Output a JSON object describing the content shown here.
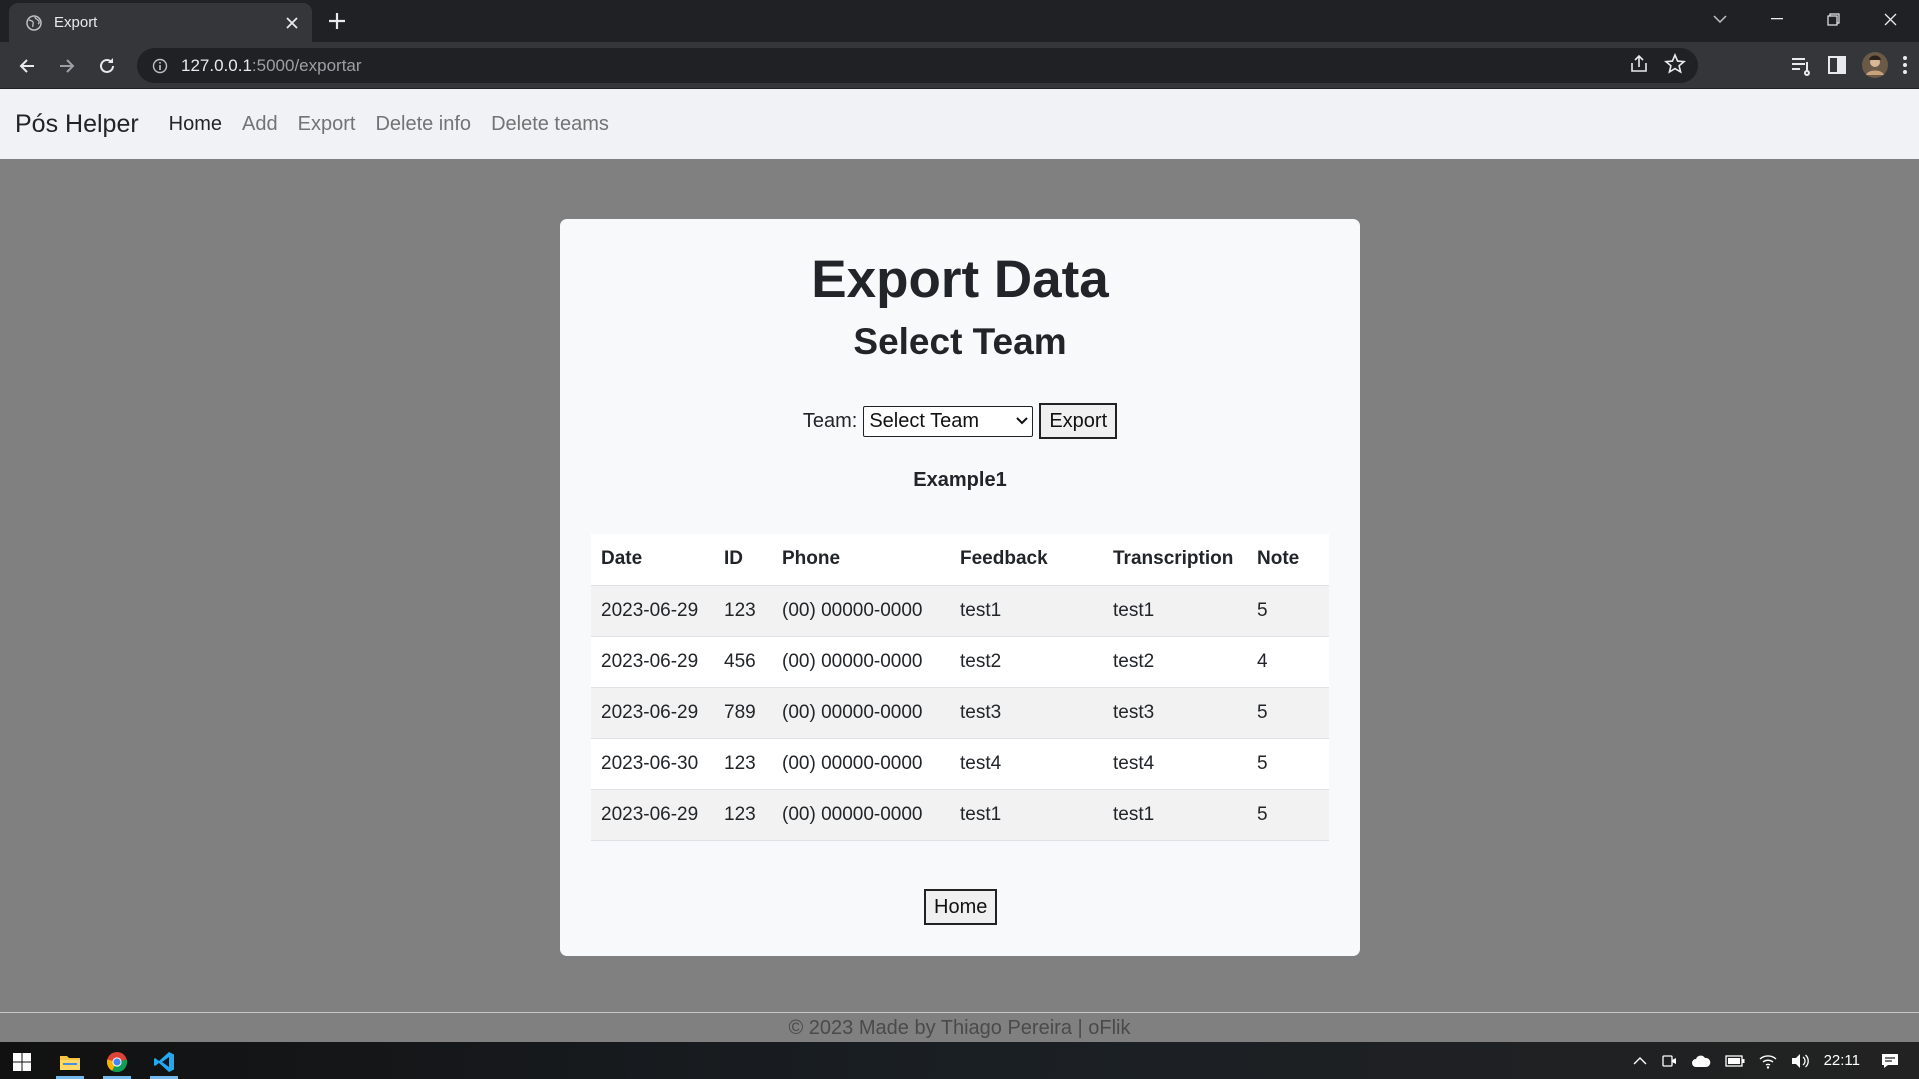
{
  "browser": {
    "tab_title": "Export",
    "url_host": "127.0.0.1",
    "url_path": ":5000/exportar"
  },
  "navbar": {
    "brand": "Pós Helper",
    "links": [
      {
        "label": "Home",
        "active": true
      },
      {
        "label": "Add",
        "active": false
      },
      {
        "label": "Export",
        "active": false
      },
      {
        "label": "Delete info",
        "active": false
      },
      {
        "label": "Delete teams",
        "active": false
      }
    ]
  },
  "page": {
    "title": "Export Data",
    "subtitle": "Select Team",
    "form": {
      "label": "Team:",
      "selected": "Select Team",
      "submit_label": "Export"
    },
    "team_name": "Example1",
    "table": {
      "headers": [
        "Date",
        "ID",
        "Phone",
        "Feedback",
        "Transcription",
        "Note"
      ],
      "rows": [
        [
          "2023-06-29",
          "123",
          "(00) 00000-0000",
          "test1",
          "test1",
          "5"
        ],
        [
          "2023-06-29",
          "456",
          "(00) 00000-0000",
          "test2",
          "test2",
          "4"
        ],
        [
          "2023-06-29",
          "789",
          "(00) 00000-0000",
          "test3",
          "test3",
          "5"
        ],
        [
          "2023-06-30",
          "123",
          "(00) 00000-0000",
          "test4",
          "test4",
          "5"
        ],
        [
          "2023-06-29",
          "123",
          "(00) 00000-0000",
          "test1",
          "test1",
          "5"
        ]
      ]
    },
    "home_button": "Home"
  },
  "footer": {
    "text": "© 2023 Made by Thiago Pereira | oFlik"
  },
  "taskbar": {
    "clock": "22:11",
    "icons": [
      "windows-start-icon",
      "file-explorer-icon",
      "chrome-icon",
      "vscode-icon"
    ]
  },
  "colors": {
    "page_bg": "#808080",
    "card_bg": "#f8f9fa",
    "navbar_bg": "#f0f2f5",
    "chrome_dark": "#202124",
    "chrome_toolbar": "#35363a"
  }
}
